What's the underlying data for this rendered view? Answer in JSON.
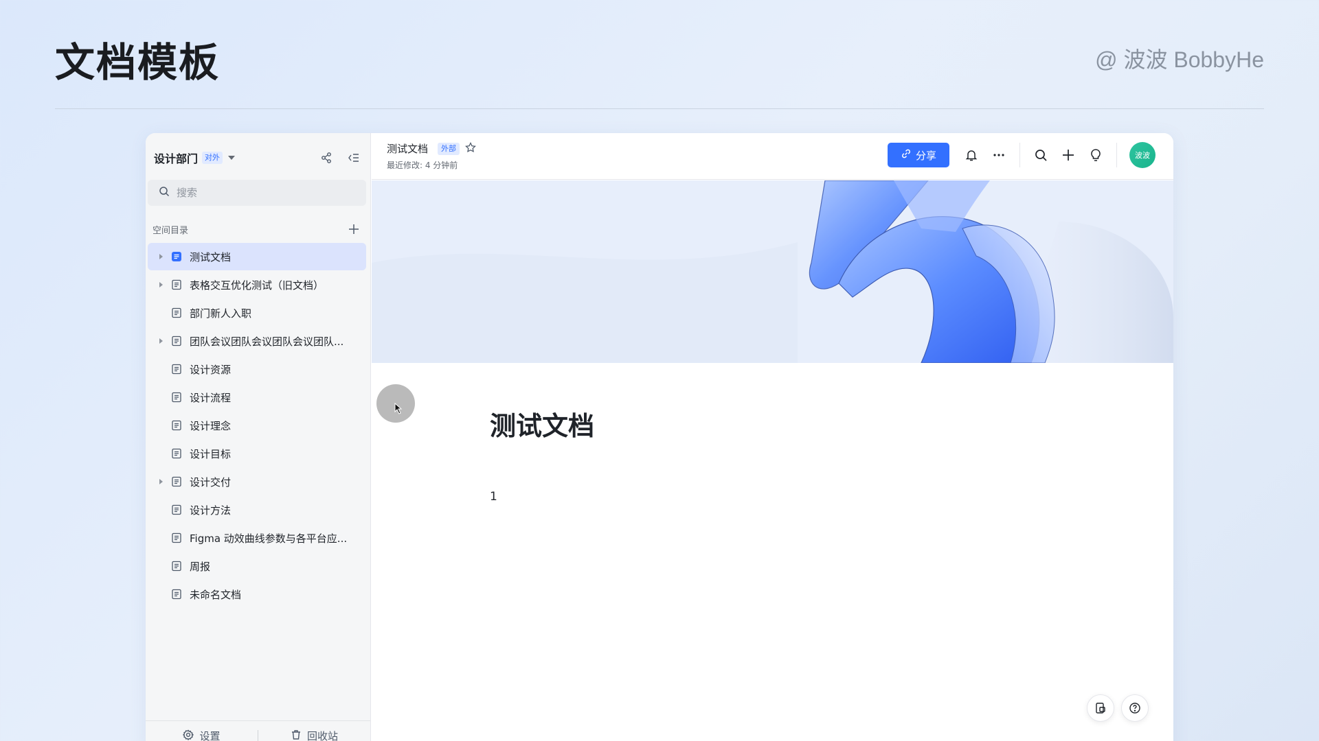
{
  "slide": {
    "title": "文档模板",
    "author": "@ 波波 BobbyHe"
  },
  "sidebar": {
    "space_name": "设计部门",
    "space_tag": "对外",
    "search_placeholder": "搜索",
    "directory_label": "空间目录",
    "items": [
      {
        "label": "测试文档",
        "has_children": true,
        "active": true
      },
      {
        "label": "表格交互优化测试（旧文档）",
        "has_children": true,
        "active": false
      },
      {
        "label": "部门新人入职",
        "has_children": false,
        "active": false
      },
      {
        "label": "团队会议团队会议团队会议团队...",
        "has_children": true,
        "active": false
      },
      {
        "label": "设计资源",
        "has_children": false,
        "active": false
      },
      {
        "label": "设计流程",
        "has_children": false,
        "active": false
      },
      {
        "label": "设计理念",
        "has_children": false,
        "active": false
      },
      {
        "label": "设计目标",
        "has_children": false,
        "active": false
      },
      {
        "label": "设计交付",
        "has_children": true,
        "active": false
      },
      {
        "label": "设计方法",
        "has_children": false,
        "active": false
      },
      {
        "label": "Figma 动效曲线参数与各平台应...",
        "has_children": false,
        "active": false
      },
      {
        "label": "周报",
        "has_children": false,
        "active": false
      },
      {
        "label": "未命名文档",
        "has_children": false,
        "active": false
      }
    ],
    "footer": {
      "settings_label": "设置",
      "trash_label": "回收站"
    }
  },
  "topbar": {
    "doc_title": "测试文档",
    "doc_tag": "外部",
    "last_modified": "最近修改: 4 分钟前",
    "share_label": "分享",
    "avatar_text": "波波"
  },
  "document": {
    "heading": "测试文档",
    "body": "1"
  },
  "colors": {
    "accent": "#3370ff",
    "active_item_bg": "#dbe3fd",
    "avatar": "#1fbd94"
  },
  "icons": [
    "share-nodes-icon",
    "collapse-sidebar-icon",
    "search-icon",
    "plus-icon",
    "chevron-right-icon",
    "document-icon",
    "link-icon",
    "star-icon",
    "bell-icon",
    "more-icon",
    "lightbulb-icon",
    "gear-icon",
    "trash-icon",
    "outline-icon",
    "help-icon"
  ]
}
